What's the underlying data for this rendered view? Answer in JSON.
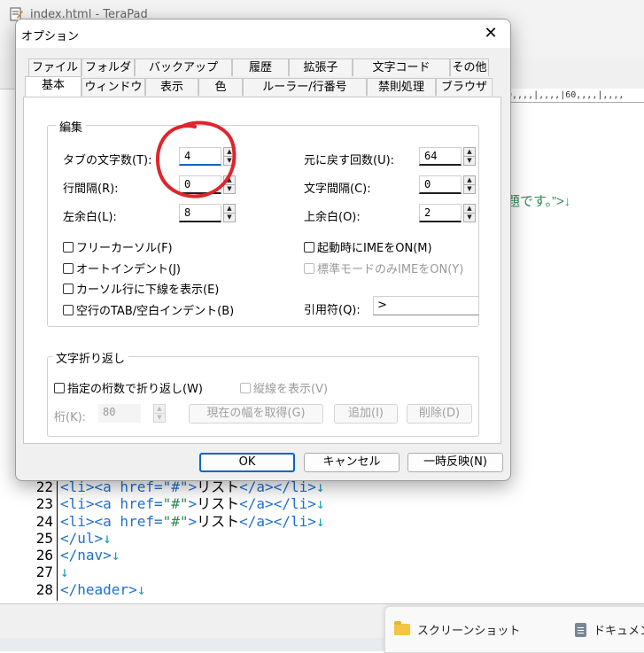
{
  "editor": {
    "window_title": "index.html - TeraPad",
    "ruler": "0,,,,|,,,,|60,,,,|,,,,",
    "partial_line": "題です。”>",
    "line_feed": "↓",
    "line_numbers": [
      "22",
      "23",
      "24",
      "25",
      "26",
      "27",
      "28"
    ],
    "code_lines": [
      {
        "tag": "<li><a href=\"#\">",
        "text": "リスト",
        "close": "</a></li>",
        "rf": "↓"
      },
      {
        "tag": "<li><a href=",
        "attr": "\"#\"",
        "tag2": ">",
        "text": "リスト",
        "close": "</a></li>",
        "rf": "↓"
      },
      {
        "tag": "<li><a href=",
        "attr": "\"#\"",
        "tag2": ">",
        "text": "リスト",
        "close": "</a></li>",
        "rf": "↓"
      },
      {
        "tag": "</ul>",
        "rf": "↓"
      },
      {
        "tag": "</nav>",
        "rf": "↓"
      },
      {
        "tag": "",
        "rf": "↓"
      },
      {
        "tag": "</header>",
        "rf": "↓"
      }
    ]
  },
  "explorer": {
    "items": [
      "スクリーンショット",
      "ドキュメン"
    ]
  },
  "dialog": {
    "title": "オプション",
    "close_glyph": "✕",
    "tabs_row1": [
      "ファイル",
      "フォルダ",
      "バックアップ",
      "履歴",
      "拡張子",
      "文字コード",
      "その他"
    ],
    "tabs_row2": [
      "基本",
      "ウィンドウ",
      "表示",
      "色",
      "ルーラー/行番号",
      "禁則処理",
      "ブラウザ"
    ],
    "active_tab": "基本",
    "edit_group": {
      "label": "編集",
      "tab_width_label": "タブの文字数(T):",
      "tab_width_value": "4",
      "line_spacing_label": "行間隔(R):",
      "line_spacing_value": "0",
      "left_margin_label": "左余白(L):",
      "left_margin_value": "8",
      "undo_count_label": "元に戻す回数(U):",
      "undo_count_value": "64",
      "char_spacing_label": "文字間隔(C):",
      "char_spacing_value": "0",
      "top_margin_label": "上余白(O):",
      "top_margin_value": "2",
      "free_cursor_label": "フリーカーソル(F)",
      "auto_indent_label": "オートインデント(J)",
      "cursor_underline_label": "カーソル行に下線を表示(E)",
      "blank_tab_label": "空行のTAB/空白インデント(B)",
      "ime_on_label": "起動時にIMEをON(M)",
      "ime_standard_label": "標準モードのみIMEをON(Y)",
      "quote_label": "引用符(Q):",
      "quote_value": ">"
    },
    "wrap_group": {
      "label": "文字折り返し",
      "wrap_at_label": "指定の桁数で折り返し(W)",
      "vertical_line_label": "縦線を表示(V)",
      "column_label": "桁(K):",
      "column_value": "80",
      "get_width_button": "現在の幅を取得(G)",
      "add_button": "追加(I)",
      "delete_button": "削除(D)"
    },
    "buttons": {
      "ok": "OK",
      "cancel": "キャンセル",
      "apply": "一時反映(N)"
    }
  },
  "annotation": {
    "color": "#e0242b"
  }
}
